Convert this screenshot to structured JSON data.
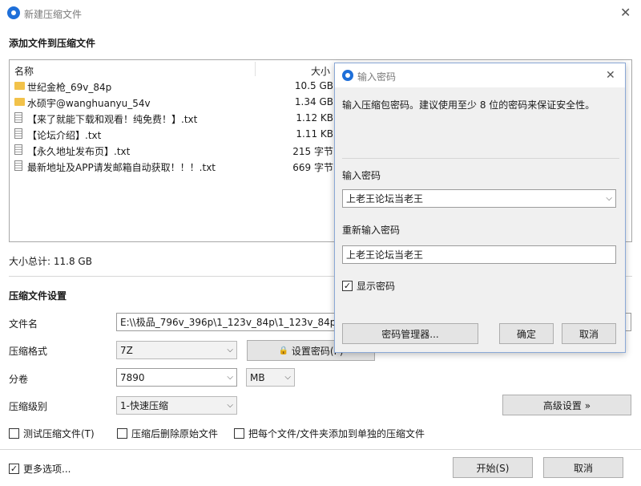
{
  "window": {
    "title": "新建压缩文件"
  },
  "section_add": "添加文件到压缩文件",
  "filelist": {
    "col_name": "名称",
    "col_size": "大小",
    "rows": [
      {
        "name": "世纪金枪_69v_84p",
        "size": "10.5 GB",
        "icon": "folder-icon"
      },
      {
        "name": "水硕宇@wanghuanyu_54v",
        "size": "1.34 GB",
        "icon": "folder-icon"
      },
      {
        "name": "【来了就能下载和观看！纯免费！】.txt",
        "size": "1.12 KB",
        "icon": "file-icon"
      },
      {
        "name": "【论坛介绍】.txt",
        "size": "1.11 KB",
        "icon": "file-icon"
      },
      {
        "name": "【永久地址发布页】.txt",
        "size": "215 字节",
        "icon": "file-icon"
      },
      {
        "name": "最新地址及APP请发邮箱自动获取！！！.txt",
        "size": "669 字节",
        "icon": "file-icon"
      }
    ]
  },
  "total_size": "大小总计: 11.8 GB",
  "section_settings": "压缩文件设置",
  "fields": {
    "filename_label": "文件名",
    "filename_value": "E:\\\\极品_796v_396p\\1_123v_84p\\1_123v_84p.7z",
    "format_label": "压缩格式",
    "format_value": "7Z",
    "set_password_button": "设置密码(P)",
    "split_label": "分卷",
    "split_value": "7890",
    "split_unit": "MB",
    "level_label": "压缩级别",
    "level_value": "1-快速压缩",
    "advanced_button": "高级设置 »"
  },
  "options": {
    "test_archive": "测试压缩文件(T)",
    "delete_after": "压缩后删除原始文件",
    "each_separate": "把每个文件/文件夹添加到单独的压缩文件",
    "more_options": "更多选项..."
  },
  "footer": {
    "start_button": "开始(S)",
    "cancel_button": "取消"
  },
  "password_dialog": {
    "title": "输入密码",
    "hint": "输入压缩包密码。建议使用至少 8 位的密码来保证安全性。",
    "enter_label": "输入密码",
    "enter_value": "上老王论坛当老王",
    "reenter_label": "重新输入密码",
    "reenter_value": "上老王论坛当老王",
    "show_password": "显示密码",
    "manager_button": "密码管理器...",
    "ok_button": "确定",
    "cancel_button": "取消"
  },
  "colors": {
    "accent": "#1e6fd9",
    "dialog_border": "#8aa8d6",
    "folder": "#f2c24a"
  }
}
